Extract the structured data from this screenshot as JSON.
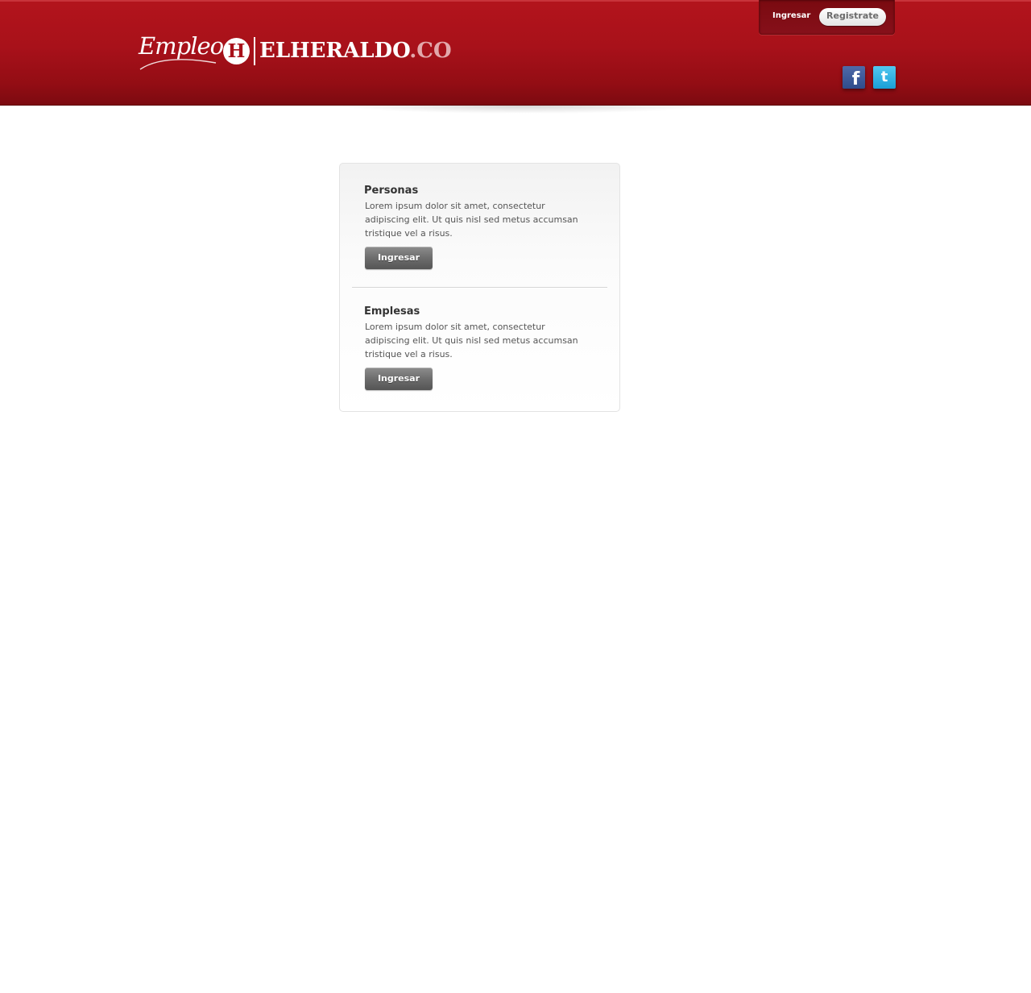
{
  "header": {
    "logo": {
      "script_text": "Empleos",
      "badge_letter": "H",
      "wordmark": "ELHERALDO",
      "tld": ".CO"
    },
    "login_link": "Ingresar",
    "register_button": "Registrate",
    "social": [
      {
        "name": "facebook-icon",
        "glyph": "f"
      },
      {
        "name": "twitter-icon",
        "glyph": "t"
      }
    ],
    "colors": {
      "header_red": "#a8111a",
      "header_dark_red": "#7c0a10"
    }
  },
  "panel": {
    "sections": [
      {
        "title": "Personas",
        "text": "Lorem ipsum dolor sit amet, consectetur adipiscing elit. Ut quis nisl sed metus accumsan tristique vel a risus.",
        "button": "Ingresar"
      },
      {
        "title": "Emplesas",
        "text": "Lorem ipsum dolor sit amet, consectetur adipiscing elit. Ut quis nisl sed metus accumsan tristique vel a risus.",
        "button": "Ingresar"
      }
    ]
  }
}
